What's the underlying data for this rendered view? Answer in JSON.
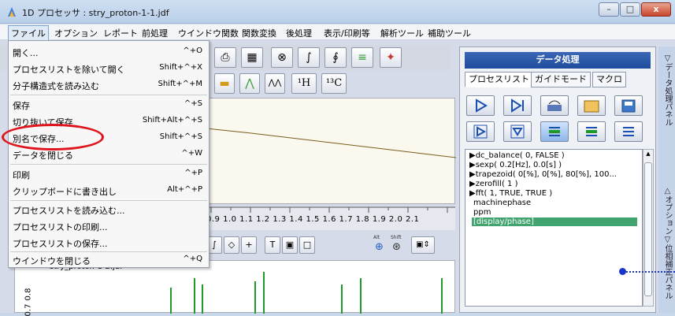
{
  "window": {
    "title": "1D プロセッサ : stry_proton-1-1.jdf",
    "minimize": "–",
    "maximize": "□",
    "close": "x"
  },
  "menubar": {
    "items": [
      "ファイル",
      "オプション",
      "レポート",
      "前処理",
      "ウインドウ関数",
      "関数変換",
      "後処理",
      "表示/印刷等",
      "解析ツール",
      "補助ツール"
    ]
  },
  "file_menu": {
    "items": [
      {
        "label": "開く...",
        "shortcut": "^+O"
      },
      {
        "label": "プロセスリストを除いて開く",
        "shortcut": "Shift+^+X"
      },
      {
        "label": "分子構造式を読み込む",
        "shortcut": "Shift+^+M"
      },
      {
        "label": "保存",
        "shortcut": "^+S"
      },
      {
        "label": "切り抜いて保存",
        "shortcut": "Shift+Alt+^+S"
      },
      {
        "label": "別名で保存...",
        "shortcut": "Shift+^+S"
      },
      {
        "label": "データを閉じる",
        "shortcut": "^+W"
      },
      {
        "label": "印刷",
        "shortcut": "^+P"
      },
      {
        "label": "クリップボードに書き出し",
        "shortcut": "Alt+^+P"
      },
      {
        "label": "プロセスリストを読み込む...",
        "shortcut": ""
      },
      {
        "label": "プロセスリストの印刷...",
        "shortcut": ""
      },
      {
        "label": "プロセスリストの保存...",
        "shortcut": ""
      },
      {
        "label": "ウインドウを閉じる",
        "shortcut": "^+Q"
      }
    ]
  },
  "toolbar": {
    "nucleus_h": "¹H",
    "nucleus_c": "¹³C",
    "alt_label": "Alt",
    "shift_label": "Shift"
  },
  "ruler": {
    "ticks": "0.9  1.0  1.1  1.2  1.3  1.4  1.5  1.6  1.7  1.8  1.9  2.0  2.1"
  },
  "bottom_plot": {
    "dataset_label": "stry_proton-1-2.jdf",
    "y_ticks": [
      "0.8",
      "0.7"
    ]
  },
  "right_panel": {
    "header": "データ処理",
    "tabs": [
      "プロセスリスト",
      "ガイドモード",
      "マクロ"
    ],
    "process_list": [
      "▶dc_balance( 0, FALSE )",
      "▶sexp( 0.2[Hz], 0.0[s] )",
      "▶trapezoid( 0[%], 0[%], 80[%], 100...",
      "▶zerofill( 1 )",
      "▶fft( 1, TRUE, TRUE )",
      "machinephase",
      "ppm",
      "[display/phase]"
    ],
    "selected_index": 7
  },
  "side_tabs": [
    "▽データ処理パネル",
    "△オプション",
    "▽位相補正パネル"
  ]
}
